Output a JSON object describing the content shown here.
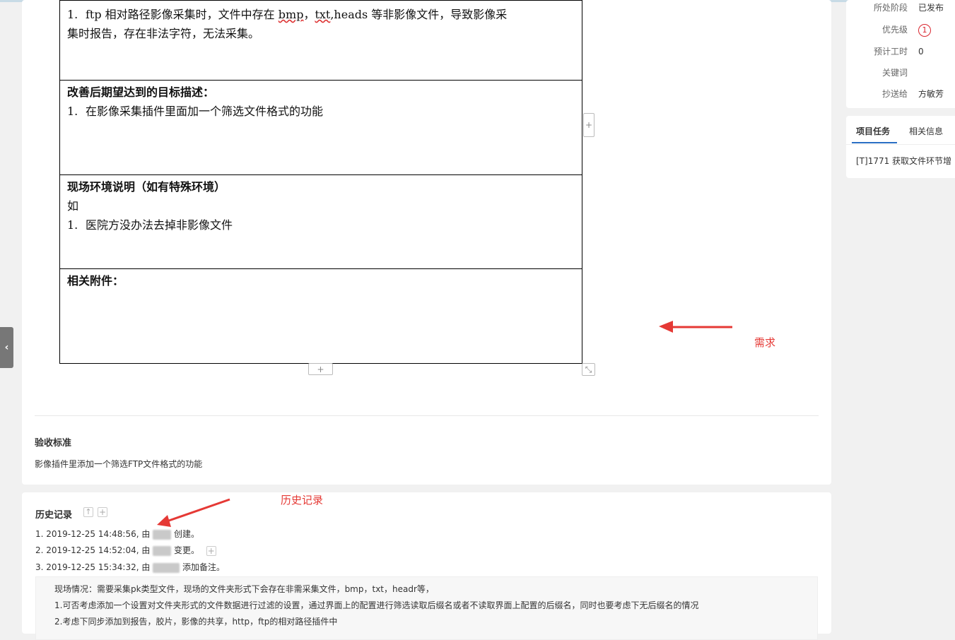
{
  "document_table": {
    "row1": {
      "num": "1.",
      "text_line1_pre": "ftp 相对路径影像采集时，文件中存在 ",
      "bmp": "bmp",
      "comma1": "，",
      "txt": "txt",
      "text_line1_post": ",heads 等非影像文件，导致影像采",
      "text_line2": "集时报告，存在非法字符，无法采集。"
    },
    "row2": {
      "heading": "改善后期望达到的目标描述：",
      "num": "1.",
      "item": "在影像采集插件里面加一个筛选文件格式的功能"
    },
    "row3": {
      "heading": "现场环境说明（如有特殊环境）",
      "prefix": "如",
      "num": "1.",
      "item": "医院方没办法去掉非影像文件"
    },
    "row4": {
      "heading": "相关附件："
    }
  },
  "editor_buttons": {
    "add_row": "+",
    "add_col": "+",
    "resize": "⤡"
  },
  "acceptance": {
    "title": "验收标准",
    "text": "影像插件里添加一个筛选FTP文件格式的功能"
  },
  "annotations": {
    "requirement": "需求",
    "history": "历史记录"
  },
  "history": {
    "title": "历史记录",
    "items": [
      {
        "prefix": "1. 2019-12-25 14:48:56, 由 ",
        "suffix": " 创建。"
      },
      {
        "prefix": "2. 2019-12-25 14:52:04, 由 ",
        "suffix": " 变更。"
      },
      {
        "prefix": "3. 2019-12-25 15:34:32, 由 ",
        "suffix": " 添加备注。"
      }
    ],
    "note_lines": [
      "现场情况：需要采集pk类型文件，现场的文件夹形式下会存在非需采集文件，bmp，txt，headr等，",
      "1.可否考虑添加一个设置对文件夹形式的文件数据进行过滤的设置，通过界面上的配置进行筛选读取后缀名或者不读取界面上配置的后缀名，同时也要考虑下无后缀名的情况",
      "2.考虑下同步添加到报告，胶片，影像的共享，http，ftp的相对路径插件中"
    ]
  },
  "info_panel": {
    "stage_label": "所处阶段",
    "stage_value": "已发布",
    "priority_label": "优先级",
    "priority_value": "1",
    "estimate_label": "预计工时",
    "estimate_value": "0",
    "keywords_label": "关键词",
    "keywords_value": "",
    "cc_label": "抄送给",
    "cc_value": "方敏芳"
  },
  "tasks_panel": {
    "tab_tasks": "项目任务",
    "tab_related": "相关信息",
    "task_item": "[T]1771 获取文件环节增"
  },
  "colors": {
    "annotation_red": "#e53935",
    "priority_red": "#d9262f",
    "tab_blue": "#2a6fc4"
  }
}
